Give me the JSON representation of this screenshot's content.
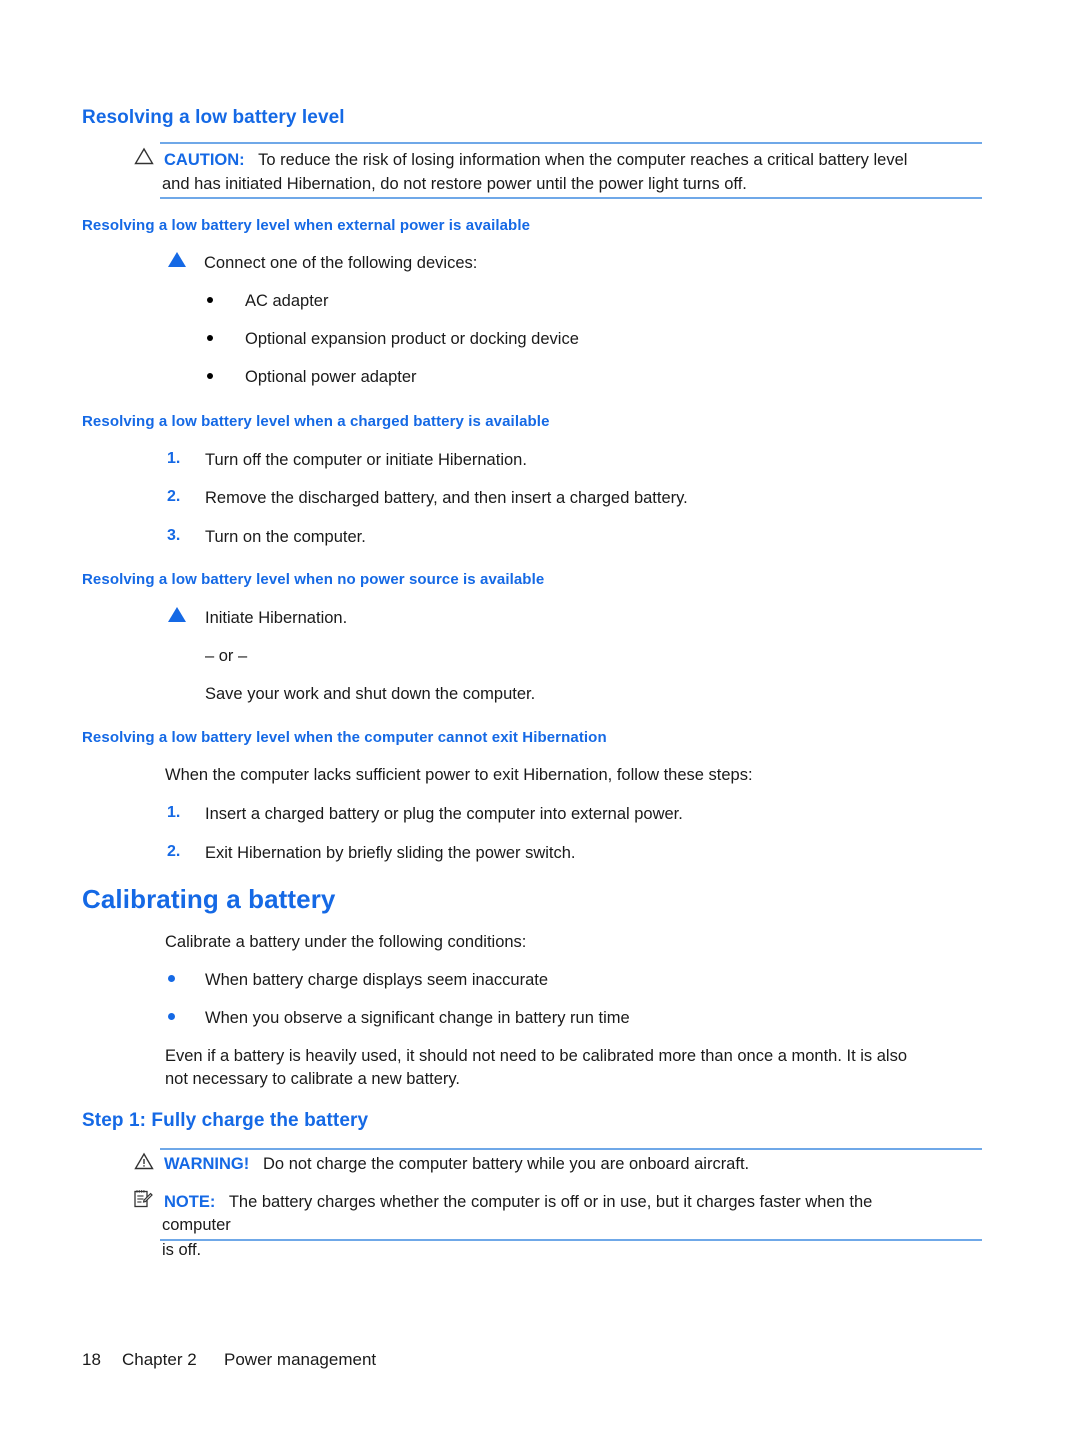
{
  "page": {
    "number": "18",
    "chapter": "Chapter 2",
    "chapter_title": "Power management"
  },
  "colors": {
    "heading_blue": "#1569e5",
    "rule_blue": "#6fa8e8",
    "body_black": "#1a1a1a"
  },
  "sections": {
    "resolving": {
      "heading": "Resolving a low battery level",
      "caution": {
        "icon": "warning-triangle-icon",
        "label": "CAUTION:",
        "line1": "To reduce the risk of losing information when the computer reaches a critical battery level",
        "line2": "and has initiated Hibernation, do not restore power until the power light turns off."
      },
      "external_power": {
        "heading": "Resolving a low battery level when external power is available",
        "lead": "Connect one of the following devices:",
        "bullets": [
          "AC adapter",
          "Optional expansion product or docking device",
          "Optional power adapter"
        ]
      },
      "charged_battery": {
        "heading": "Resolving a low battery level when a charged battery is available",
        "steps": [
          {
            "num": "1.",
            "text": "Turn off the computer or initiate Hibernation."
          },
          {
            "num": "2.",
            "text": "Remove the discharged battery, and then insert a charged battery."
          },
          {
            "num": "3.",
            "text": "Turn on the computer."
          }
        ]
      },
      "no_power": {
        "heading": "Resolving a low battery level when no power source is available",
        "lead": "Initiate Hibernation.",
        "or_text": "– or –",
        "alt": "Save your work and shut down the computer."
      },
      "cannot_exit": {
        "heading": "Resolving a low battery level when the computer cannot exit Hibernation",
        "lead": "When the computer lacks sufficient power to exit Hibernation, follow these steps:",
        "steps": [
          {
            "num": "1.",
            "text": "Insert a charged battery or plug the computer into external power."
          },
          {
            "num": "2.",
            "text": "Exit Hibernation by briefly sliding the power switch."
          }
        ]
      }
    },
    "calibrating": {
      "heading": "Calibrating a battery",
      "lead": "Calibrate a battery under the following conditions:",
      "bullets": [
        "When battery charge displays seem inaccurate",
        "When you observe a significant change in battery run time"
      ],
      "paragraph_line1": "Even if a battery is heavily used, it should not need to be calibrated more than once a month. It is also",
      "paragraph_line2": "not necessary to calibrate a new battery.",
      "step1": {
        "heading": "Step 1: Fully charge the battery",
        "warning": {
          "icon": "warning-exclamation-triangle-icon",
          "label": "WARNING!",
          "text": "Do not charge the computer battery while you are onboard aircraft."
        },
        "note": {
          "icon": "note-pencil-icon",
          "label": "NOTE:",
          "line1": "The battery charges whether the computer is off or in use, but it charges faster when the",
          "line2": "computer is off."
        }
      }
    }
  }
}
